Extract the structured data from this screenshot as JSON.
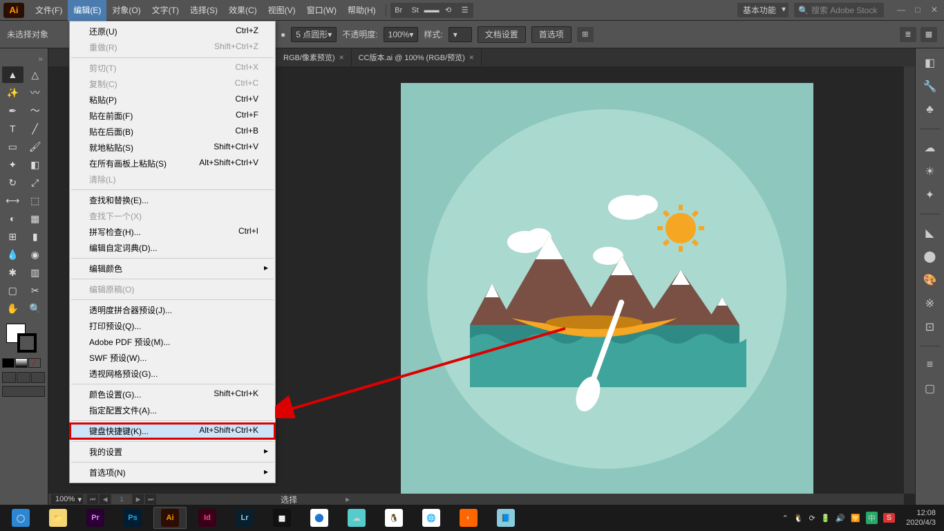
{
  "app": {
    "logo": "Ai"
  },
  "menubar": {
    "items": [
      "文件(F)",
      "编辑(E)",
      "对象(O)",
      "文字(T)",
      "选择(S)",
      "效果(C)",
      "视图(V)",
      "窗口(W)",
      "帮助(H)"
    ],
    "active_index": 1,
    "workspace": "基本功能",
    "search_placeholder": "搜索 Adobe Stock",
    "br": "Br",
    "st": "St"
  },
  "controlbar": {
    "no_selection": "未选择对象",
    "stroke_style": "5 点圆形",
    "opacity_label": "不透明度:",
    "opacity": "100%",
    "style_label": "样式:",
    "doc_setup": "文档设置",
    "preferences": "首选项"
  },
  "tabs": [
    {
      "label": "RGB/像素预览)"
    },
    {
      "label": "CC版本.ai @ 100% (RGB/预览)"
    }
  ],
  "edit_menu": {
    "undo": {
      "label": "还原(U)",
      "shortcut": "Ctrl+Z"
    },
    "redo": {
      "label": "重做(R)",
      "shortcut": "Shift+Ctrl+Z"
    },
    "cut": {
      "label": "剪切(T)",
      "shortcut": "Ctrl+X"
    },
    "copy": {
      "label": "复制(C)",
      "shortcut": "Ctrl+C"
    },
    "paste": {
      "label": "粘贴(P)",
      "shortcut": "Ctrl+V"
    },
    "paste_front": {
      "label": "贴在前面(F)",
      "shortcut": "Ctrl+F"
    },
    "paste_back": {
      "label": "贴在后面(B)",
      "shortcut": "Ctrl+B"
    },
    "paste_place": {
      "label": "就地粘贴(S)",
      "shortcut": "Shift+Ctrl+V"
    },
    "paste_all": {
      "label": "在所有画板上粘贴(S)",
      "shortcut": "Alt+Shift+Ctrl+V"
    },
    "clear": {
      "label": "清除(L)"
    },
    "find_replace": {
      "label": "查找和替换(E)..."
    },
    "find_next": {
      "label": "查找下一个(X)"
    },
    "spell": {
      "label": "拼写检查(H)...",
      "shortcut": "Ctrl+I"
    },
    "dict": {
      "label": "编辑自定词典(D)..."
    },
    "edit_colors": {
      "label": "编辑颜色"
    },
    "edit_original": {
      "label": "编辑原稿(O)"
    },
    "trans_preset": {
      "label": "透明度拼合器预设(J)..."
    },
    "print_preset": {
      "label": "打印预设(Q)..."
    },
    "pdf_preset": {
      "label": "Adobe PDF 预设(M)..."
    },
    "swf_preset": {
      "label": "SWF 预设(W)..."
    },
    "persp_preset": {
      "label": "透视网格预设(G)..."
    },
    "color_settings": {
      "label": "颜色设置(G)...",
      "shortcut": "Shift+Ctrl+K"
    },
    "assign_profile": {
      "label": "指定配置文件(A)..."
    },
    "keyboard": {
      "label": "键盘快捷键(K)...",
      "shortcut": "Alt+Shift+Ctrl+K"
    },
    "my_settings": {
      "label": "我的设置"
    },
    "prefs": {
      "label": "首选项(N)"
    }
  },
  "statusbar": {
    "zoom": "100%",
    "artboard_num": "1",
    "sel_label": "选择"
  },
  "clock": {
    "time": "12:08",
    "date": "2020/4/3"
  },
  "tray": {
    "ime": "中",
    "sogou": "S"
  }
}
